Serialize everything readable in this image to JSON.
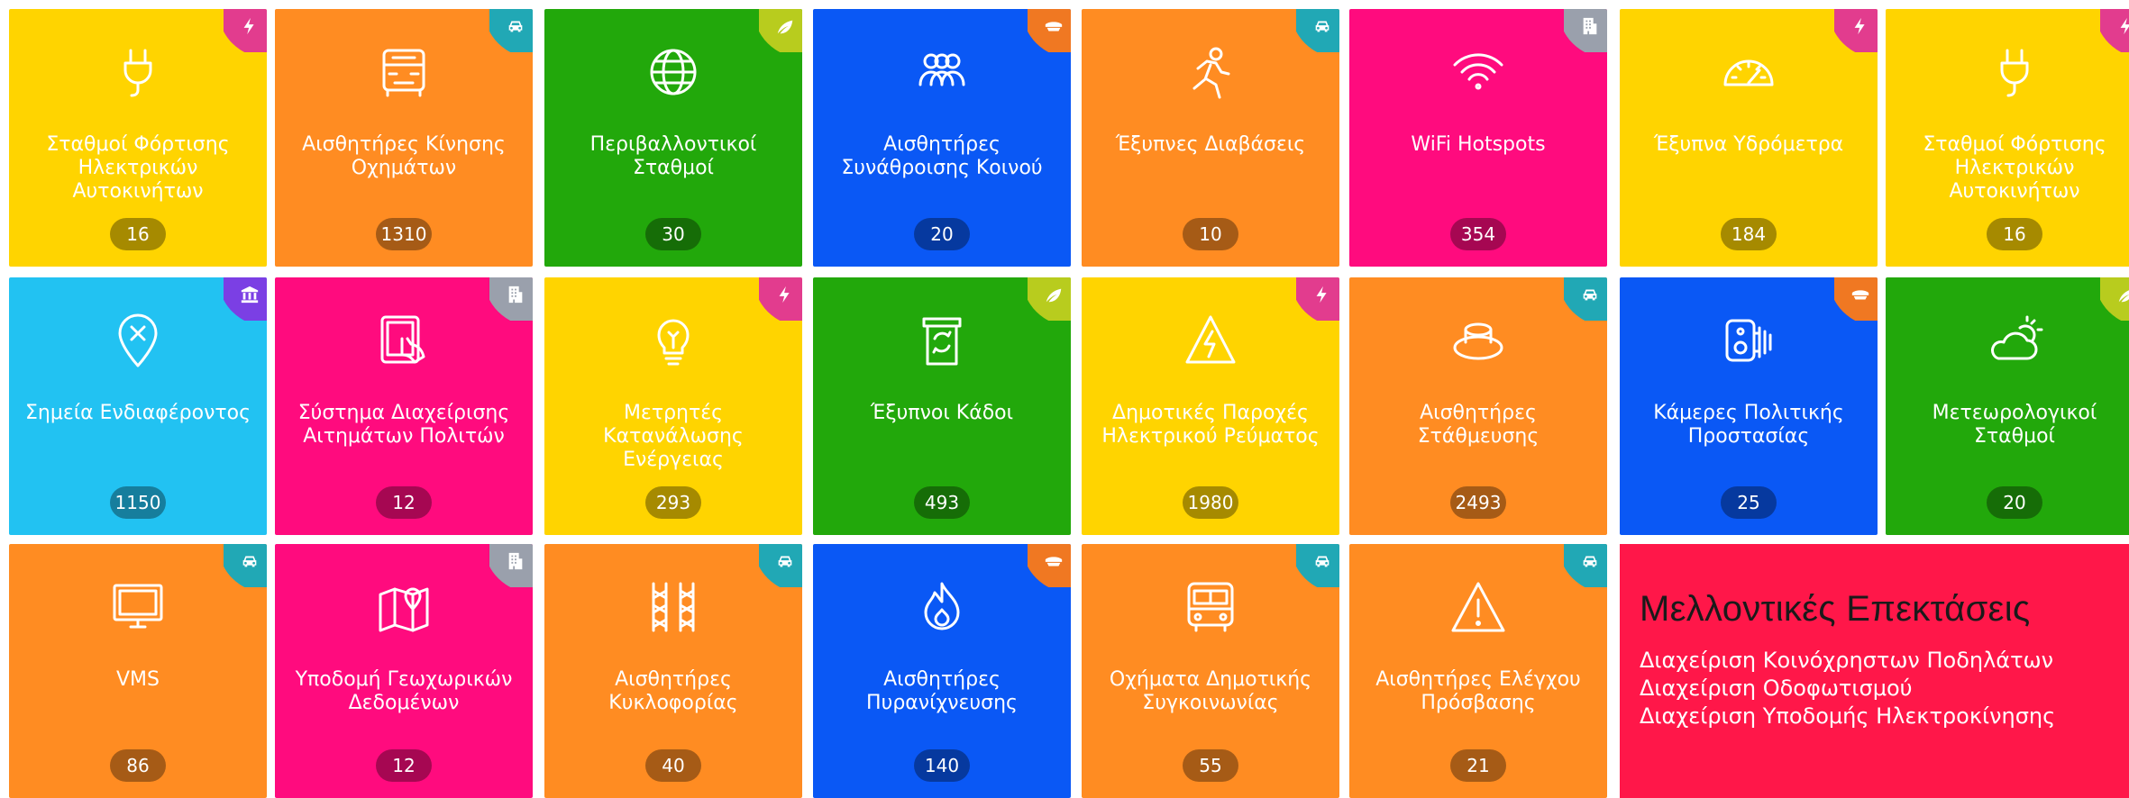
{
  "colors": {
    "yellow": "#FFD400",
    "orange": "#FF8C22",
    "green": "#22A80B",
    "blue": "#0A58F5",
    "pink": "#FF0B7E",
    "cyan": "#22C2F2",
    "future_panel": "#FF1749"
  },
  "tiles": [
    {
      "label": "Σταθμοί Φόρτισης Ηλεκτρικών Αυτοκινήτων",
      "count": "16",
      "color": "yellow",
      "icon": "plug-icon",
      "category": "energy-bolt-icon"
    },
    {
      "label": "Αισθητήρες Κίνησης Οχημάτων",
      "count": "1310",
      "color": "orange",
      "icon": "truck-front-icon",
      "category": "car-icon"
    },
    {
      "label": "Περιβαλλοντικοί Σταθμοί",
      "count": "30",
      "color": "green",
      "icon": "globe-icon",
      "category": "leaf-icon"
    },
    {
      "label": "Αισθητήρες Συνάθροισης Κοινού",
      "count": "20",
      "color": "blue",
      "icon": "crowd-icon",
      "category": "police-cap-icon"
    },
    {
      "label": "Έξυπνες Διαβάσεις",
      "count": "10",
      "color": "orange",
      "icon": "pedestrian-icon",
      "category": "car-icon"
    },
    {
      "label": "WiFi Hotspots",
      "count": "354",
      "color": "pink",
      "icon": "wifi-icon",
      "category": "building-icon"
    },
    {
      "label": "Έξυπνα Υδρόμετρα",
      "count": "184",
      "color": "yellow",
      "icon": "gauge-icon",
      "category": "energy-bolt-icon"
    },
    {
      "label": "Σταθμοί Φόρτισης Ηλεκτρικών Αυτοκινήτων",
      "count": "16",
      "color": "yellow",
      "icon": "plug-icon",
      "category": "energy-bolt-icon"
    },
    {
      "label": "Σημεία Ενδιαφέροντος",
      "count": "1150",
      "color": "cyan",
      "icon": "map-pin-x-icon",
      "category": "museum-icon"
    },
    {
      "label": "Σύστημα Διαχείρισης Αιτημάτων Πολιτών",
      "count": "12",
      "color": "pink",
      "icon": "tablet-touch-icon",
      "category": "building-icon"
    },
    {
      "label": "Μετρητές Κατανάλωσης Ενέργειας",
      "count": "293",
      "color": "yellow",
      "icon": "lightbulb-icon",
      "category": "energy-bolt-icon"
    },
    {
      "label": "Έξυπνοι Κάδοι",
      "count": "493",
      "color": "green",
      "icon": "recycle-bin-icon",
      "category": "leaf-icon"
    },
    {
      "label": "Δημοτικές Παροχές Ηλεκτρικού Ρεύματος",
      "count": "1980",
      "color": "yellow",
      "icon": "high-voltage-icon",
      "category": "energy-bolt-icon"
    },
    {
      "label": "Αισθητήρες Στάθμευσης",
      "count": "2493",
      "color": "orange",
      "icon": "parking-sensor-icon",
      "category": "car-icon"
    },
    {
      "label": "Κάμερες Πολιτικής Προστασίας",
      "count": "25",
      "color": "blue",
      "icon": "camera-icon",
      "category": "police-cap-icon"
    },
    {
      "label": "Μετεωρολογικοί Σταθμοί",
      "count": "20",
      "color": "green",
      "icon": "sun-cloud-icon",
      "category": "leaf-icon"
    },
    {
      "label": "VMS",
      "count": "86",
      "color": "orange",
      "icon": "monitor-icon",
      "category": "car-icon"
    },
    {
      "label": "Υποδομή Γεωχωρικών Δεδομένων",
      "count": "12",
      "color": "pink",
      "icon": "map-icon",
      "category": "building-icon"
    },
    {
      "label": "Αισθητήρες Κυκλοφορίας",
      "count": "40",
      "color": "orange",
      "icon": "road-lanes-icon",
      "category": "car-icon"
    },
    {
      "label": "Αισθητήρες Πυρανίχνευσης",
      "count": "140",
      "color": "blue",
      "icon": "flame-icon",
      "category": "police-cap-icon"
    },
    {
      "label": "Οχήματα Δημοτικής Συγκοινωνίας",
      "count": "55",
      "color": "orange",
      "icon": "bus-icon",
      "category": "car-icon"
    },
    {
      "label": "Αισθητήρες Ελέγχου Πρόσβασης",
      "count": "21",
      "color": "orange",
      "icon": "warning-icon",
      "category": "car-icon"
    }
  ],
  "future": {
    "title": "Μελλοντικές Επεκτάσεις",
    "items": [
      "Διαχείριση Κοινόχρηστων Ποδηλάτων",
      "Διαχείριση Οδοφωτισμού",
      "Διαχείριση Υποδομής Ηλεκτροκίνησης"
    ]
  }
}
